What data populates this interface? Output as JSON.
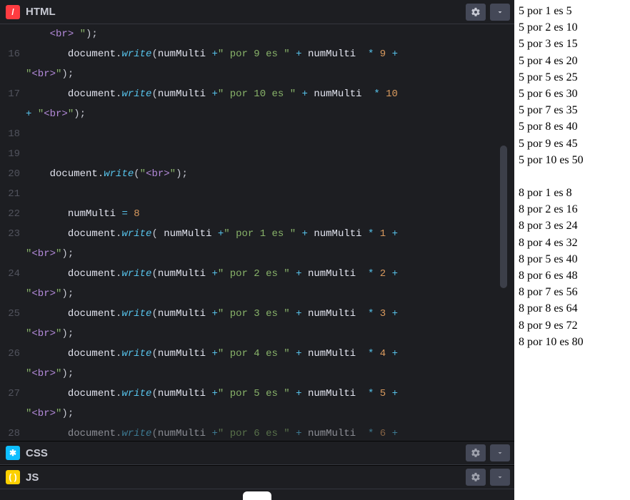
{
  "panels": {
    "html": {
      "label": "HTML",
      "icon": "/"
    },
    "css": {
      "label": "CSS",
      "icon": "✱"
    },
    "js": {
      "label": "JS",
      "icon": "( )"
    }
  },
  "gutter": [
    "",
    "16",
    "",
    "17",
    "",
    "18",
    "19",
    "20",
    "21",
    "22",
    "23",
    "",
    "24",
    "",
    "25",
    "",
    "26",
    "",
    "27",
    "",
    "28"
  ],
  "code_lines": [
    {
      "i": 1,
      "t": "cont",
      "parts": [
        {
          "c": "",
          "t": "    "
        },
        {
          "c": "str",
          "t": "<br>"
        },
        {
          "c": "str",
          "t": " "
        },
        {
          "c": "str",
          "t": "\""
        },
        {
          "c": "punc",
          "t": ");"
        }
      ]
    },
    {
      "i": 2,
      "t": "write",
      "indent": "       ",
      "arg_parts": [
        "numMulti",
        " +",
        "\" por 9 es \"",
        " + ",
        "numMulti",
        "  * ",
        "9",
        " + "
      ]
    },
    {
      "i": 3,
      "t": "tail"
    },
    {
      "i": 4,
      "t": "write",
      "indent": "       ",
      "arg_parts": [
        "numMulti",
        " +",
        "\" por 10 es \"",
        " + ",
        "numMulti",
        "  * ",
        "10"
      ]
    },
    {
      "i": 5,
      "t": "tail2"
    },
    {
      "i": 6,
      "t": "blank"
    },
    {
      "i": 7,
      "t": "blank"
    },
    {
      "i": 8,
      "t": "writebr",
      "indent": "    "
    },
    {
      "i": 9,
      "t": "blank"
    },
    {
      "i": 10,
      "t": "assign",
      "indent": "       ",
      "var": "numMulti",
      "val": "8"
    },
    {
      "i": 11,
      "t": "write",
      "indent": "       ",
      "space": true,
      "arg_parts": [
        "numMulti",
        " +",
        "\" por 1 es \"",
        " + ",
        "numMulti",
        " * ",
        "1",
        " + "
      ]
    },
    {
      "i": 12,
      "t": "tail"
    },
    {
      "i": 13,
      "t": "write",
      "indent": "       ",
      "arg_parts": [
        "numMulti",
        " +",
        "\" por 2 es \"",
        " + ",
        "numMulti",
        "  * ",
        "2",
        " + "
      ]
    },
    {
      "i": 14,
      "t": "tail"
    },
    {
      "i": 15,
      "t": "write",
      "indent": "       ",
      "arg_parts": [
        "numMulti",
        " +",
        "\" por 3 es \"",
        " + ",
        "numMulti",
        "  * ",
        "3",
        " + "
      ]
    },
    {
      "i": 16,
      "t": "tail"
    },
    {
      "i": 17,
      "t": "write",
      "indent": "       ",
      "arg_parts": [
        "numMulti",
        " +",
        "\" por 4 es \"",
        " + ",
        "numMulti",
        "  * ",
        "4",
        " + "
      ]
    },
    {
      "i": 18,
      "t": "tail"
    },
    {
      "i": 19,
      "t": "write",
      "indent": "       ",
      "arg_parts": [
        "numMulti",
        " +",
        "\" por 5 es \"",
        " + ",
        "numMulti",
        "  * ",
        "5",
        " + "
      ]
    },
    {
      "i": 20,
      "t": "tail"
    },
    {
      "i": 21,
      "t": "write",
      "indent": "       ",
      "arg_parts": [
        "numMulti",
        " +",
        "\" por 6 es \"",
        " + ",
        "numMulti",
        "  * ",
        "6",
        " + "
      ],
      "fade": true
    }
  ],
  "output": {
    "block1": {
      "n": "5",
      "lines": [
        [
          "1",
          "5"
        ],
        [
          "2",
          "10"
        ],
        [
          "3",
          "15"
        ],
        [
          "4",
          "20"
        ],
        [
          "5",
          "25"
        ],
        [
          "6",
          "30"
        ],
        [
          "7",
          "35"
        ],
        [
          "8",
          "40"
        ],
        [
          "9",
          "45"
        ],
        [
          "10",
          "50"
        ]
      ]
    },
    "block2": {
      "n": "8",
      "lines": [
        [
          "1",
          "8"
        ],
        [
          "2",
          "16"
        ],
        [
          "3",
          "24"
        ],
        [
          "4",
          "32"
        ],
        [
          "5",
          "40"
        ],
        [
          "6",
          "48"
        ],
        [
          "7",
          "56"
        ],
        [
          "8",
          "64"
        ],
        [
          "9",
          "72"
        ],
        [
          "10",
          "80"
        ]
      ]
    }
  },
  "icons": {
    "gear": "gear-icon",
    "chevron": "chevron-down-icon"
  }
}
